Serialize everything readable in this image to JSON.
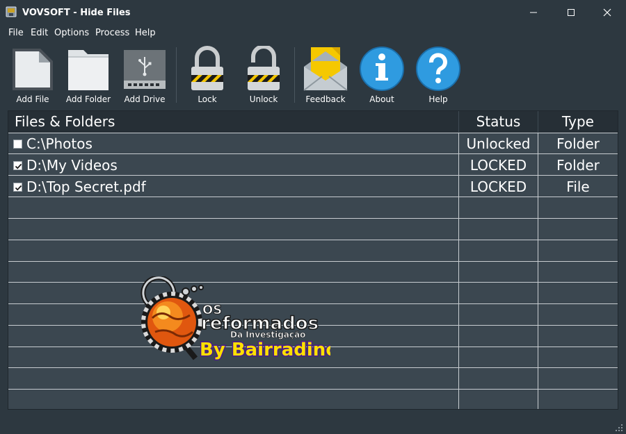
{
  "window": {
    "title": "VOVSOFT - Hide Files",
    "icon": "app-icon",
    "minimize_icon": "minimize-icon",
    "maximize_icon": "maximize-icon",
    "close_icon": "close-icon"
  },
  "menu": {
    "items": [
      {
        "label": "File"
      },
      {
        "label": "Edit"
      },
      {
        "label": "Options"
      },
      {
        "label": "Process"
      },
      {
        "label": "Help"
      }
    ]
  },
  "toolbar": {
    "buttons": [
      {
        "label": "Add File",
        "icon": "file-icon"
      },
      {
        "label": "Add Folder",
        "icon": "folder-icon"
      },
      {
        "label": "Add Drive",
        "icon": "usb-drive-icon"
      },
      {
        "label": "Lock",
        "icon": "padlock-locked-icon"
      },
      {
        "label": "Unlock",
        "icon": "padlock-unlocked-icon"
      },
      {
        "label": "Feedback",
        "icon": "envelope-icon"
      },
      {
        "label": "About",
        "icon": "info-icon"
      },
      {
        "label": "Help",
        "icon": "question-icon"
      }
    ]
  },
  "grid": {
    "columns": [
      "Files & Folders",
      "Status",
      "Type"
    ],
    "rows": [
      {
        "checked": false,
        "path": "C:\\Photos",
        "status": "Unlocked",
        "type": "Folder"
      },
      {
        "checked": true,
        "path": "D:\\My Videos",
        "status": "LOCKED",
        "type": "Folder"
      },
      {
        "checked": true,
        "path": "D:\\Top Secret.pdf",
        "status": "LOCKED",
        "type": "File"
      }
    ]
  },
  "watermark": {
    "line1": "OS",
    "line2": "reformados",
    "line3": "Da Investigação",
    "line4": "By Bairradino",
    "icon": "magnifier-globe-logo"
  },
  "colors": {
    "background": "#2d3840",
    "grid_background": "#3b4750",
    "header_background": "#262f36",
    "gridline": "#c8cdd1",
    "accent_blue": "#2f9be0",
    "watermark_purple": "#4a1a8c",
    "watermark_yellow": "#ffe000"
  },
  "statusbar": {
    "grip_icon": "resize-grip-icon"
  }
}
